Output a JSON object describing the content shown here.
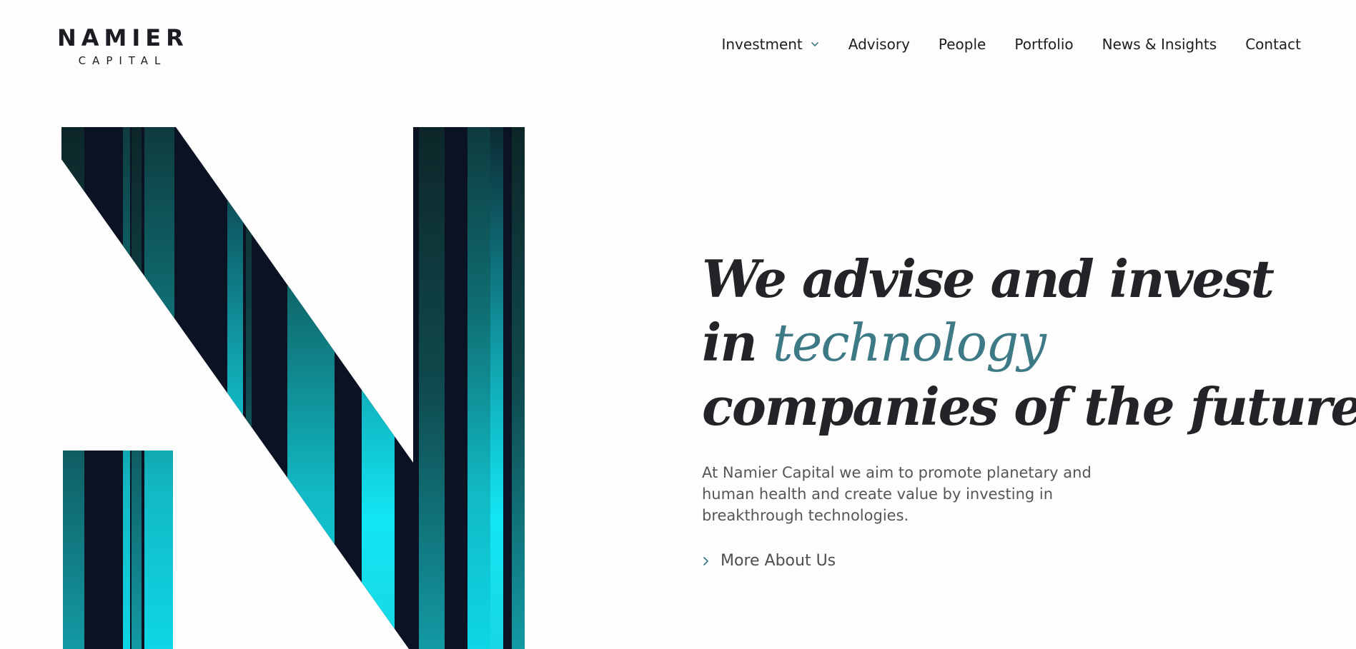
{
  "brand": {
    "name_top": "NAMIER",
    "name_bottom": "CAPITAL"
  },
  "nav": {
    "items": [
      {
        "label": "Investment",
        "has_dropdown": true
      },
      {
        "label": "Advisory"
      },
      {
        "label": "People"
      },
      {
        "label": "Portfolio"
      },
      {
        "label": "News & Insights"
      },
      {
        "label": "Contact"
      }
    ]
  },
  "hero": {
    "title_line1": "We advise and invest",
    "title_line2_prefix": "in ",
    "title_line2_accent": "technology",
    "title_line3": "companies of the future",
    "description": "At Namier Capital we aim to promote planetary and human health and create value by investing in breakthrough technologies.",
    "cta_label": "More About Us"
  },
  "icons": {
    "dropdown": "chevron-down-icon",
    "cta": "chevron-right-icon"
  },
  "colors": {
    "text_dark": "#242428",
    "accent": "#3e7a86",
    "body_text": "#565659",
    "graphic_dark": "#0b1224",
    "graphic_teal": "#12e6f4"
  }
}
